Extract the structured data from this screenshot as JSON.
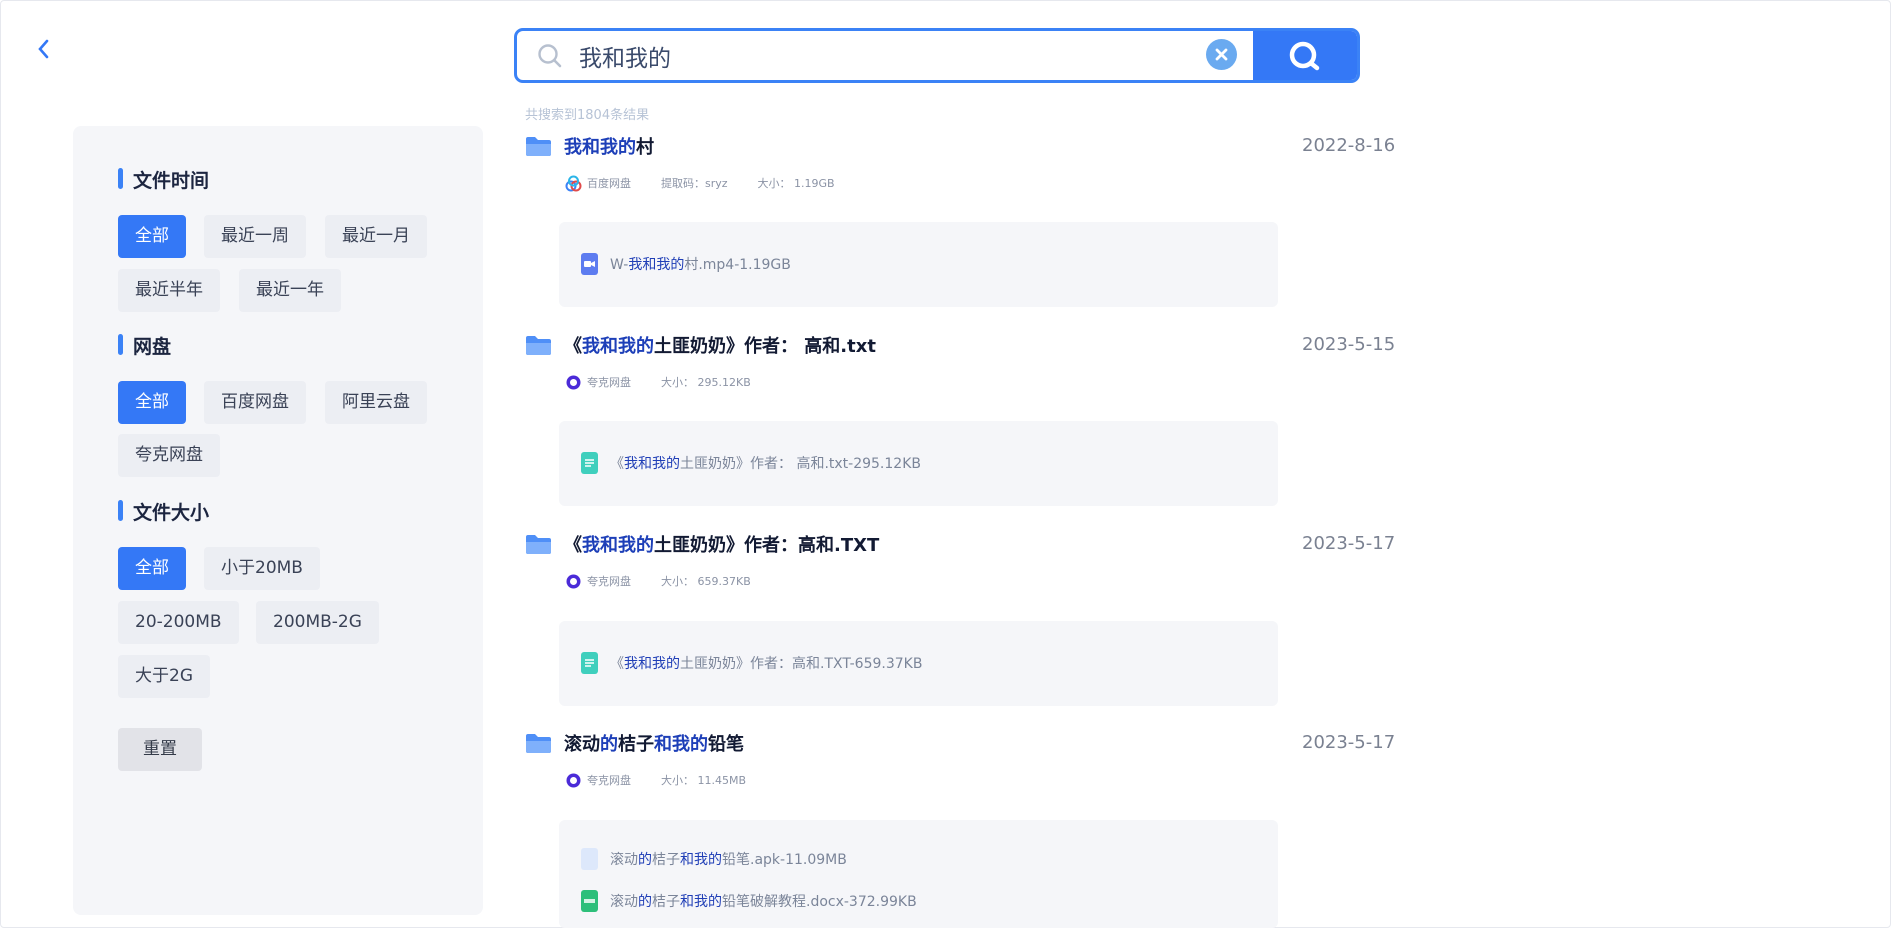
{
  "search": {
    "query": "我和我的",
    "result_count_text": "共搜索到1804条结果"
  },
  "filters": {
    "time": {
      "title": "文件时间",
      "options": [
        "全部",
        "最近一周",
        "最近一月",
        "最近半年",
        "最近一年"
      ]
    },
    "disk": {
      "title": "网盘",
      "options": [
        "全部",
        "百度网盘",
        "阿里云盘",
        "夸克网盘"
      ]
    },
    "size": {
      "title": "文件大小",
      "options": [
        "全部",
        "小于20MB",
        "20-200MB",
        "200MB-2G",
        "大于2G"
      ]
    },
    "reset_label": "重置"
  },
  "results": [
    {
      "title_hl": "我和我的",
      "title_rest": "村",
      "date": "2022-8-16",
      "disk": "百度网盘",
      "code": "提取码：sryz",
      "size": "大小： 1.19GB",
      "files": [
        {
          "pre": "W-",
          "hl": "我和我的",
          "post": "村.mp4-1.19GB",
          "icon": "video-file-icon"
        }
      ]
    },
    {
      "title_pre": "《",
      "title_hl": "我和我的",
      "title_rest": "土匪奶奶》作者： 高和.txt",
      "date": "2023-5-15",
      "disk": "夸克网盘",
      "size": "大小： 295.12KB",
      "files": [
        {
          "pre": "《",
          "hl": "我和我的",
          "post": "土匪奶奶》作者： 高和.txt-295.12KB",
          "icon": "text-file-icon"
        }
      ]
    },
    {
      "title_pre": "《",
      "title_hl": "我和我的",
      "title_rest": "土匪奶奶》作者：高和.TXT",
      "date": "2023-5-17",
      "disk": "夸克网盘",
      "size": "大小： 659.37KB",
      "files": [
        {
          "pre": "《",
          "hl": "我和我的",
          "post": "土匪奶奶》作者：高和.TXT-659.37KB",
          "icon": "text-file-icon"
        }
      ]
    },
    {
      "title_a": "滚动",
      "title_b": "的",
      "title_c": "桔子",
      "title_d": "和我的",
      "title_e": "铅笔",
      "date": "2023-5-17",
      "disk": "夸克网盘",
      "size": "大小： 11.45MB",
      "files": [
        {
          "a": "滚动",
          "b": "的",
          "c": "桔子",
          "d": "和我的",
          "e": "铅笔.apk-11.09MB",
          "icon": "folder-file-icon"
        },
        {
          "a": "滚动",
          "b": "的",
          "c": "桔子",
          "d": "和我的",
          "e": "铅笔破解教程.docx-372.99KB",
          "icon": "doc-file-icon"
        }
      ]
    }
  ],
  "colors": {
    "accent": "#3478f6",
    "highlight": "#1d3fb8",
    "panel": "#f5f6f9"
  }
}
